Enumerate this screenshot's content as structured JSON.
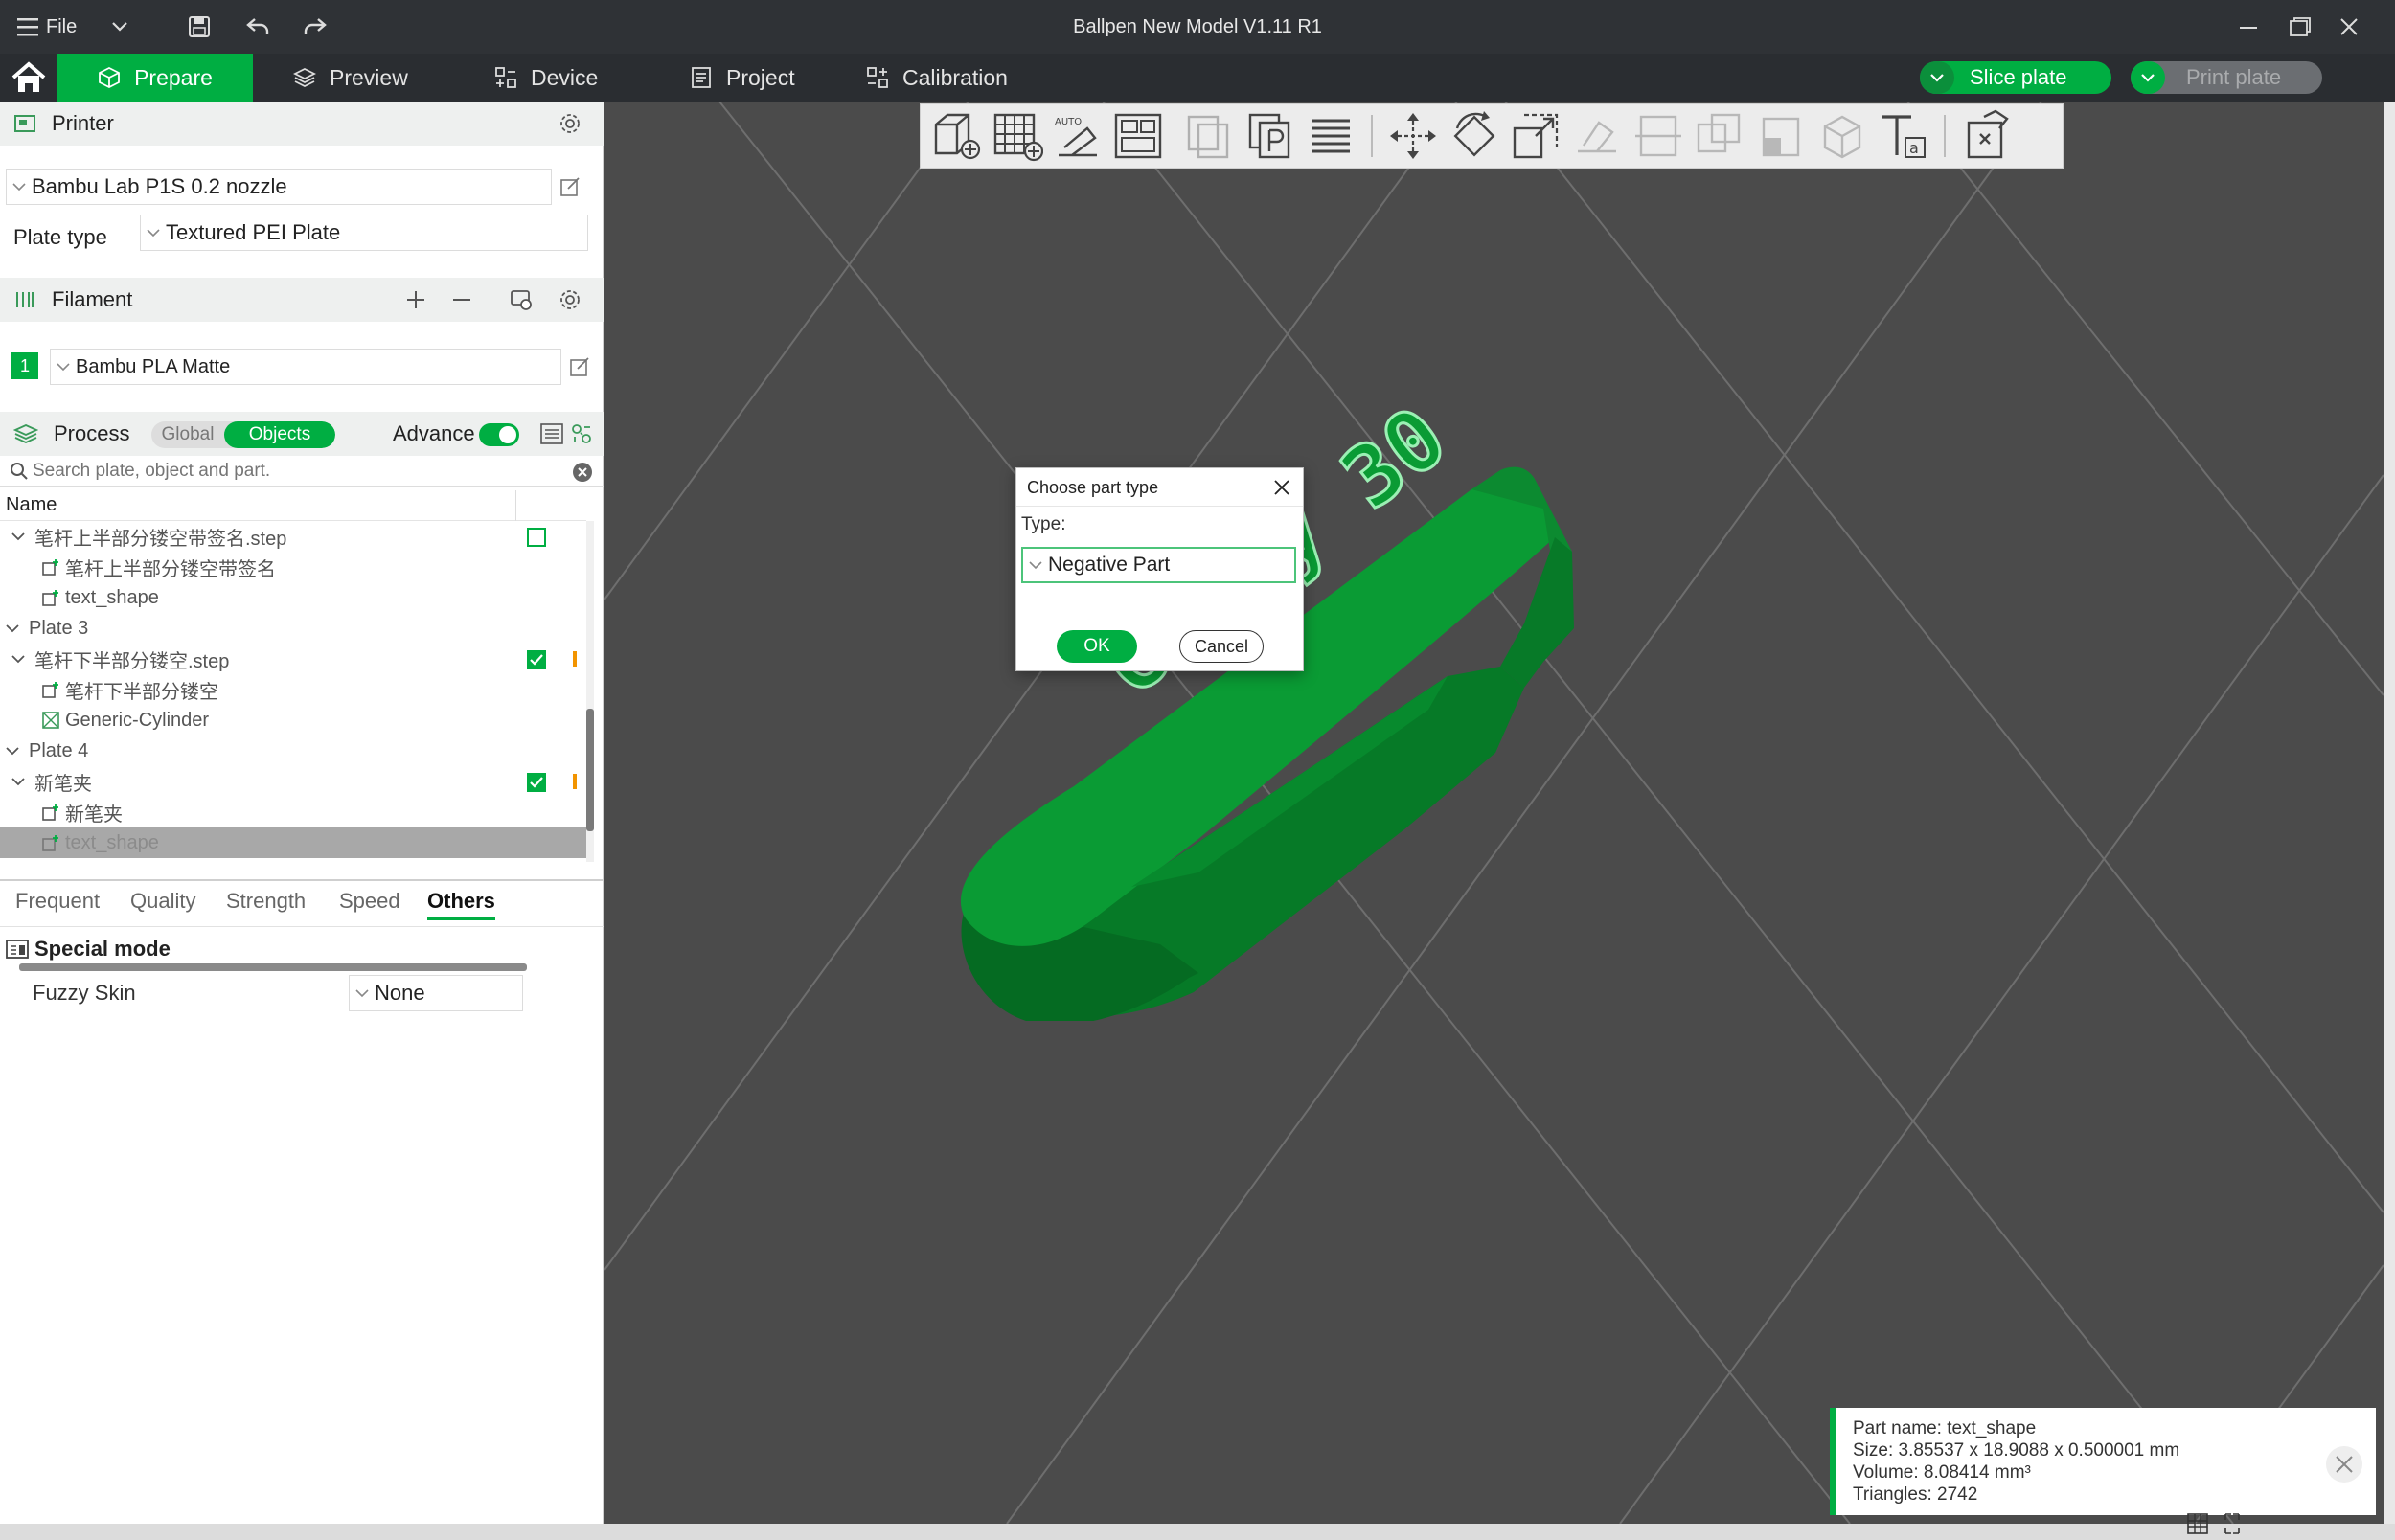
{
  "window": {
    "title": "Ballpen New Model V1.11 R1",
    "file_label": "File"
  },
  "tabs": {
    "prepare": "Prepare",
    "preview": "Preview",
    "device": "Device",
    "project": "Project",
    "calibration": "Calibration"
  },
  "actions": {
    "slice": "Slice plate",
    "print": "Print plate"
  },
  "printer": {
    "section": "Printer",
    "model": "Bambu Lab P1S 0.2 nozzle",
    "plate_type_label": "Plate type",
    "plate_type": "Textured PEI Plate"
  },
  "filament": {
    "section": "Filament",
    "slot": "1",
    "name": "Bambu PLA Matte"
  },
  "process": {
    "section": "Process",
    "global": "Global",
    "objects": "Objects",
    "advance": "Advance"
  },
  "search": {
    "placeholder": "Search plate, object and part."
  },
  "tree": {
    "header": "Name",
    "rows": [
      {
        "label": "笔杆上半部分镂空带签名.step"
      },
      {
        "label": "笔杆上半部分镂空带签名"
      },
      {
        "label": "text_shape"
      },
      {
        "label": "Plate 3"
      },
      {
        "label": "笔杆下半部分镂空.step"
      },
      {
        "label": "笔杆下半部分镂空"
      },
      {
        "label": "Generic-Cylinder"
      },
      {
        "label": "Plate 4"
      },
      {
        "label": "新笔夹"
      },
      {
        "label": "新笔夹"
      },
      {
        "label": "text_shape"
      }
    ]
  },
  "param_tabs": {
    "frequent": "Frequent",
    "quality": "Quality",
    "strength": "Strength",
    "speed": "Speed",
    "others": "Others"
  },
  "special": {
    "title": "Special mode",
    "fuzzy_label": "Fuzzy Skin",
    "fuzzy_value": "None"
  },
  "dialog": {
    "title": "Choose part type",
    "type_label": "Type:",
    "value": "Negative Part",
    "ok": "OK",
    "cancel": "Cancel"
  },
  "model": {
    "text": "Curry 30"
  },
  "info": {
    "line1": "Part name: text_shape",
    "line2": "Size: 3.85537 x 18.9088 x 0.500001 mm",
    "line3": "Volume: 8.08414 mm³",
    "line4": "Triangles: 2742"
  },
  "colors": {
    "accent": "#00ae42",
    "viewport_bg": "#4b4b4b",
    "model_green": "#0a9b34"
  }
}
